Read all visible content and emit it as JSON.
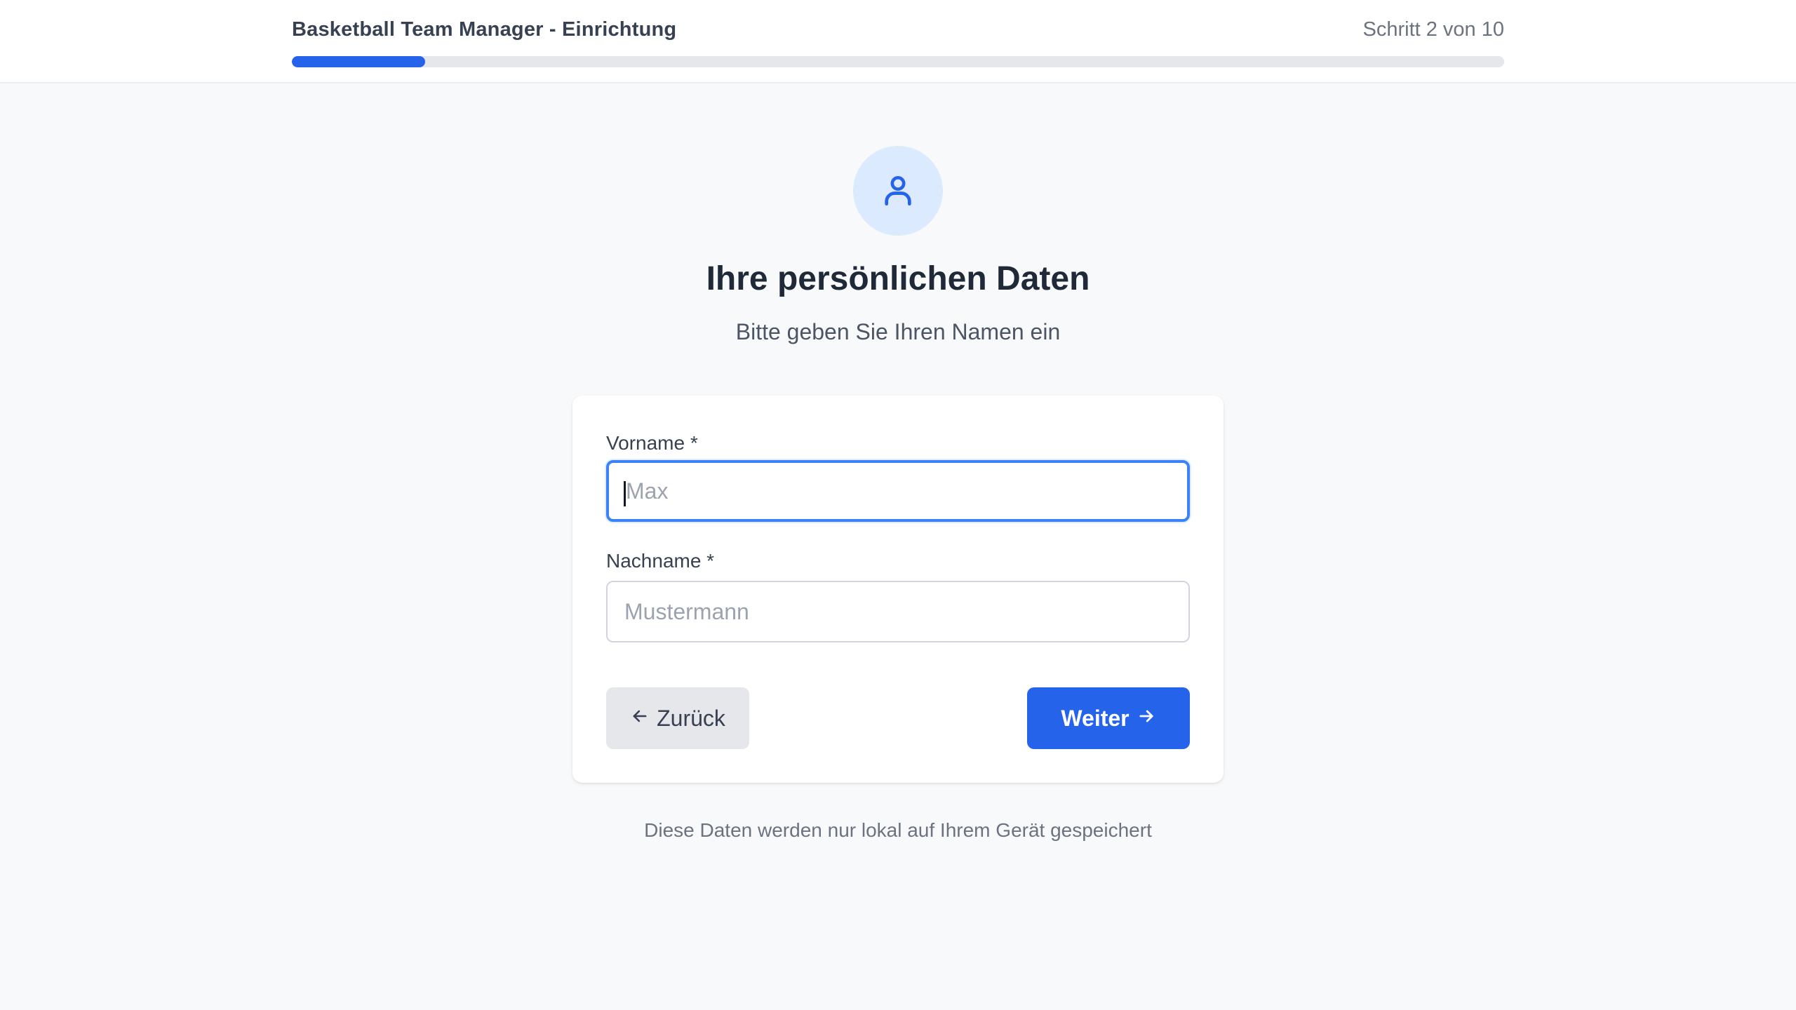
{
  "header": {
    "title": "Basketball Team Manager - Einrichtung",
    "step_label": "Schritt 2 von 10",
    "progress_fraction": 0.11
  },
  "step": {
    "icon": "user-icon",
    "title": "Ihre persönlichen Daten",
    "subtitle": "Bitte geben Sie Ihren Namen ein"
  },
  "form": {
    "first_name": {
      "label": "Vorname *",
      "placeholder": "Max",
      "value": ""
    },
    "last_name": {
      "label": "Nachname *",
      "placeholder": "Mustermann",
      "value": ""
    },
    "back_label": "Zurück",
    "next_label": "Weiter"
  },
  "footer": {
    "note": "Diese Daten werden nur lokal auf Ihrem Gerät gespeichert"
  },
  "colors": {
    "accent": "#2563eb",
    "icon_bg": "#dbeafe",
    "focus_ring": "#3b82f6"
  }
}
